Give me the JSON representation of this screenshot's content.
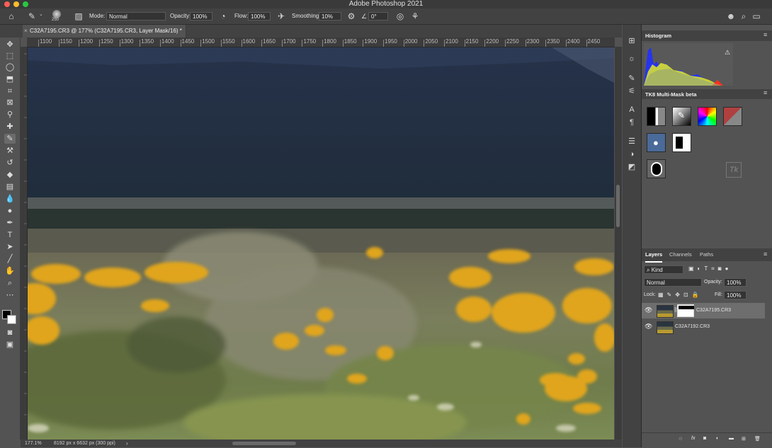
{
  "app": {
    "title": "Adobe Photoshop 2021"
  },
  "options_bar": {
    "brush_size": "250",
    "mode_label": "Mode:",
    "mode_value": "Normal",
    "opacity_label": "Opacity:",
    "opacity_value": "100%",
    "flow_label": "Flow:",
    "flow_value": "100%",
    "smoothing_label": "Smoothing:",
    "smoothing_value": "10%",
    "angle_value": "0°"
  },
  "document": {
    "tab_title": "C32A7195.CR3 @ 177% (C32A7195.CR3, Layer Mask/16) *",
    "ruler_labels": [
      "1100",
      "1150",
      "1200",
      "1250",
      "1300",
      "1350",
      "1400",
      "1450",
      "1500",
      "1550",
      "1600",
      "1650",
      "1700",
      "1750",
      "1800",
      "1850",
      "1900",
      "1950",
      "2000",
      "2050",
      "2100",
      "2150",
      "2200",
      "2250",
      "2300",
      "2350",
      "2400",
      "2450"
    ]
  },
  "status_bar": {
    "zoom": "177.1%",
    "doc_info": "8192 px x 6632 px (300 ppi)"
  },
  "panels": {
    "histogram": {
      "title": "Histogram"
    },
    "tk8": {
      "title": "TK8 Multi-Mask beta"
    },
    "layers": {
      "tabs": [
        "Layers",
        "Channels",
        "Paths"
      ],
      "filter_value": "Kind",
      "blend_mode": "Normal",
      "opacity_label": "Opacity:",
      "opacity_value": "100%",
      "lock_label": "Lock:",
      "fill_label": "Fill:",
      "fill_value": "100%",
      "items": [
        {
          "name": "C32A7195.CR3",
          "selected": true,
          "has_mask": true
        },
        {
          "name": "C32A7192.CR3",
          "selected": false,
          "has_mask": false
        }
      ]
    }
  },
  "colors": {
    "accent": "#2680eb",
    "panel_bg": "#535353",
    "dark_bg": "#424242",
    "selected_row": "#6e6e6e"
  }
}
